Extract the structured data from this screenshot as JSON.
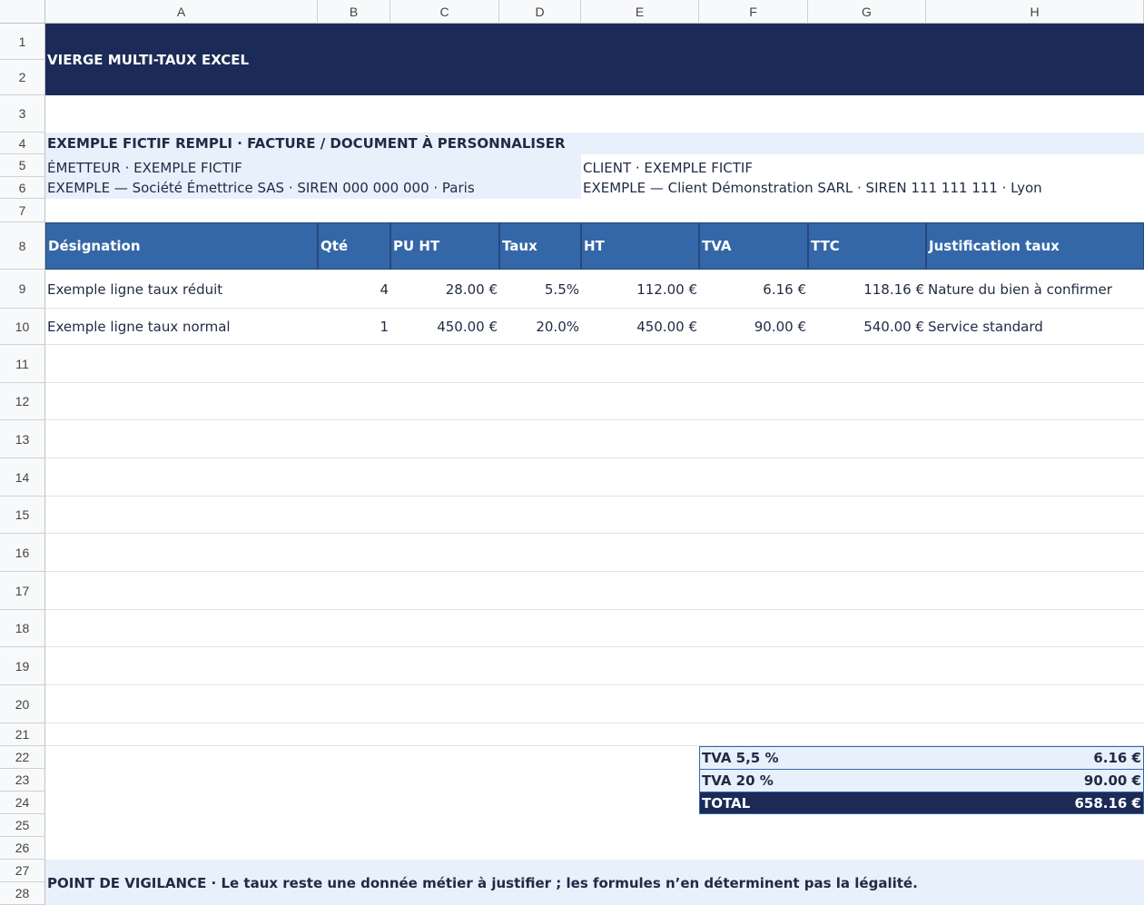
{
  "columns": [
    "A",
    "B",
    "C",
    "D",
    "E",
    "F",
    "G",
    "H"
  ],
  "rows": [
    "1",
    "2",
    "3",
    "4",
    "5",
    "6",
    "7",
    "8",
    "9",
    "10",
    "11",
    "12",
    "13",
    "14",
    "15",
    "16",
    "17",
    "18",
    "19",
    "20",
    "21",
    "22",
    "23",
    "24",
    "25",
    "26",
    "27",
    "28"
  ],
  "title": "VIERGE MULTI-TAUX EXCEL",
  "section_title": "EXEMPLE FICTIF REMPLI · FACTURE / DOCUMENT À PERSONNALISER",
  "emitter": {
    "label": "ÉMETTEUR · EXEMPLE FICTIF",
    "value": "EXEMPLE — Société Émettrice SAS · SIREN 000 000 000 · Paris"
  },
  "client": {
    "label": "CLIENT · EXEMPLE FICTIF",
    "value": "EXEMPLE — Client Démonstration SARL · SIREN 111 111 111 · Lyon"
  },
  "table": {
    "headers": [
      "Désignation",
      "Qté",
      "PU HT",
      "Taux",
      "HT",
      "TVA",
      "TTC",
      "Justification taux"
    ],
    "rows": [
      [
        "Exemple ligne taux réduit",
        "4",
        "28.00 €",
        "5.5%",
        "112.00 €",
        "6.16 €",
        "118.16 €",
        "Nature du bien à confirmer"
      ],
      [
        "Exemple ligne taux normal",
        "1",
        "450.00 €",
        "20.0%",
        "450.00 €",
        "90.00 €",
        "540.00 €",
        "Service standard"
      ]
    ]
  },
  "totals": [
    {
      "label": "TVA 5,5 %",
      "value": "6.16 €"
    },
    {
      "label": "TVA 20 %",
      "value": "90.00 €"
    },
    {
      "label": "TOTAL",
      "value": "658.16 €"
    }
  ],
  "warning": {
    "label": "POINT DE VIGILANCE",
    "text": "POINT DE VIGILANCE · Le taux reste une donnée métier à justifier ; les formules n’en déterminent pas la légalité."
  },
  "colors": {
    "title_bg": "#1b2a57",
    "header_bg": "#3467a8",
    "light_band": "#e8f0fb",
    "text": "#1f2a44"
  }
}
